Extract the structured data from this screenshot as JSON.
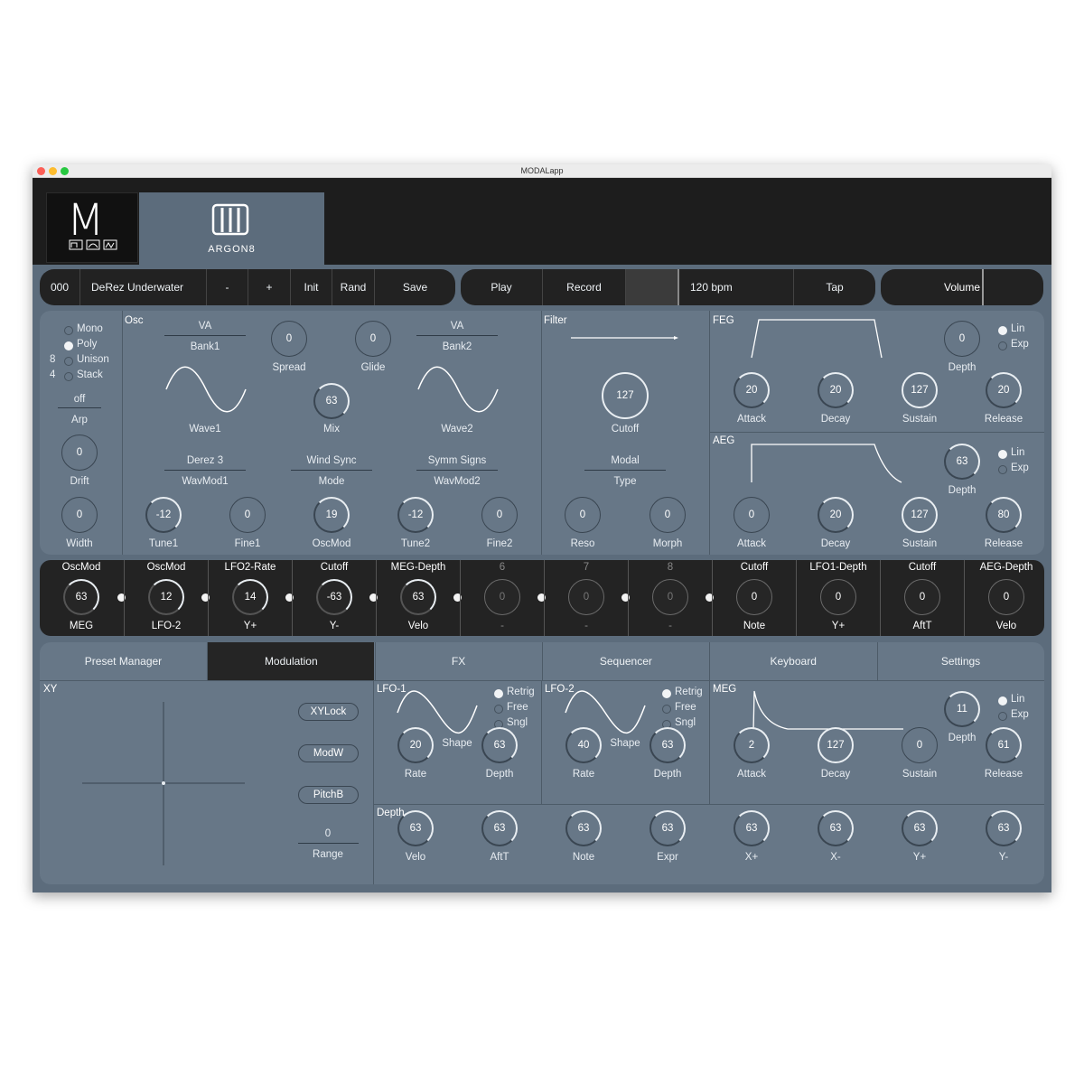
{
  "window": {
    "title": "MODALapp"
  },
  "header": {
    "logo_m": "M",
    "logo_sub": "ARGON8"
  },
  "toolbar": {
    "preset_number": "000",
    "preset_name": "DeRez Underwater",
    "minus": "-",
    "plus": "+",
    "init": "Init",
    "rand": "Rand",
    "save": "Save",
    "play": "Play",
    "record": "Record",
    "tempo": "120 bpm",
    "tap": "Tap",
    "volume": "Volume"
  },
  "voice": {
    "modes": [
      "Mono",
      "Poly",
      "Unison",
      "Stack"
    ],
    "selected_mode": "Poly",
    "unison_count": "8",
    "stack_count": "4",
    "arp_value": "off",
    "arp_label": "Arp",
    "drift_value": "0",
    "drift_label": "Drift",
    "width_value": "0",
    "width_label": "Width"
  },
  "osc": {
    "title": "Osc",
    "bank1_value": "VA",
    "bank1_label": "Bank1",
    "bank2_value": "VA",
    "bank2_label": "Bank2",
    "spread_value": "0",
    "spread_label": "Spread",
    "glide_value": "0",
    "glide_label": "Glide",
    "mix_value": "63",
    "mix_label": "Mix",
    "wave1_label": "Wave1",
    "wave2_label": "Wave2",
    "wavmod1_value": "Derez 3",
    "wavmod1_label": "WavMod1",
    "mode_value": "Wind Sync",
    "mode_label": "Mode",
    "wavmod2_value": "Symm Signs",
    "wavmod2_label": "WavMod2",
    "tune1_value": "-12",
    "tune1_label": "Tune1",
    "fine1_value": "0",
    "fine1_label": "Fine1",
    "oscmod_value": "19",
    "oscmod_label": "OscMod",
    "tune2_value": "-12",
    "tune2_label": "Tune2",
    "fine2_value": "0",
    "fine2_label": "Fine2"
  },
  "filter": {
    "title": "Filter",
    "cutoff_value": "127",
    "cutoff_label": "Cutoff",
    "type_value": "Modal",
    "type_label": "Type",
    "reso_value": "0",
    "reso_label": "Reso",
    "morph_value": "0",
    "morph_label": "Morph"
  },
  "feg": {
    "title": "FEG",
    "depth_value": "0",
    "depth_label": "Depth",
    "curve_options": [
      "Lin",
      "Exp"
    ],
    "curve_selected": "Lin",
    "attack_value": "20",
    "attack_label": "Attack",
    "decay_value": "20",
    "decay_label": "Decay",
    "sustain_value": "127",
    "sustain_label": "Sustain",
    "release_value": "20",
    "release_label": "Release"
  },
  "aeg": {
    "title": "AEG",
    "depth_value": "63",
    "depth_label": "Depth",
    "curve_options": [
      "Lin",
      "Exp"
    ],
    "curve_selected": "Lin",
    "attack_value": "0",
    "attack_label": "Attack",
    "decay_value": "20",
    "decay_label": "Decay",
    "sustain_value": "127",
    "sustain_label": "Sustain",
    "release_value": "80",
    "release_label": "Release"
  },
  "mod_matrix": [
    {
      "dest": "OscMod",
      "value": "63",
      "source": "MEG",
      "active": true
    },
    {
      "dest": "OscMod",
      "value": "12",
      "source": "LFO-2",
      "active": true
    },
    {
      "dest": "LFO2-Rate",
      "value": "14",
      "source": "Y+",
      "active": true
    },
    {
      "dest": "Cutoff",
      "value": "-63",
      "source": "Y-",
      "active": true
    },
    {
      "dest": "MEG-Depth",
      "value": "63",
      "source": "Velo",
      "active": true
    },
    {
      "dest": "6",
      "value": "0",
      "source": "-",
      "active": false
    },
    {
      "dest": "7",
      "value": "0",
      "source": "-",
      "active": false
    },
    {
      "dest": "8",
      "value": "0",
      "source": "-",
      "active": false
    },
    {
      "dest": "Cutoff",
      "value": "0",
      "source": "Note",
      "active": true
    },
    {
      "dest": "LFO1-Depth",
      "value": "0",
      "source": "Y+",
      "active": true
    },
    {
      "dest": "Cutoff",
      "value": "0",
      "source": "AftT",
      "active": true
    },
    {
      "dest": "AEG-Depth",
      "value": "0",
      "source": "Velo",
      "active": true
    }
  ],
  "tabs": [
    "Preset Manager",
    "Modulation",
    "FX",
    "Sequencer",
    "Keyboard",
    "Settings"
  ],
  "active_tab": "Modulation",
  "xy": {
    "title": "XY",
    "xylock": "XYLock",
    "modw": "ModW",
    "pitchb": "PitchB",
    "range_value": "0",
    "range_label": "Range"
  },
  "lfo1": {
    "title": "LFO-1",
    "options": [
      "Retrig",
      "Free",
      "Sngl"
    ],
    "selected": "Retrig",
    "shape_label": "Shape",
    "rate_value": "20",
    "rate_label": "Rate",
    "depth_value": "63",
    "depth_label": "Depth"
  },
  "lfo2": {
    "title": "LFO-2",
    "options": [
      "Retrig",
      "Free",
      "Sngl"
    ],
    "selected": "Retrig",
    "shape_label": "Shape",
    "rate_value": "40",
    "rate_label": "Rate",
    "depth_value": "63",
    "depth_label": "Depth"
  },
  "meg": {
    "title": "MEG",
    "depth_value": "11",
    "depth_label": "Depth",
    "curve_options": [
      "Lin",
      "Exp"
    ],
    "curve_selected": "Lin",
    "attack_value": "2",
    "attack_label": "Attack",
    "decay_value": "127",
    "decay_label": "Decay",
    "sustain_value": "0",
    "sustain_label": "Sustain",
    "release_value": "61",
    "release_label": "Release"
  },
  "depth": {
    "title": "Depth",
    "items": [
      {
        "value": "63",
        "label": "Velo"
      },
      {
        "value": "63",
        "label": "AftT"
      },
      {
        "value": "63",
        "label": "Note"
      },
      {
        "value": "63",
        "label": "Expr"
      },
      {
        "value": "63",
        "label": "X+"
      },
      {
        "value": "63",
        "label": "X-"
      },
      {
        "value": "63",
        "label": "Y+"
      },
      {
        "value": "63",
        "label": "Y-"
      }
    ]
  },
  "colors": {
    "panel": "#677787",
    "background": "#5c6c7c",
    "dark": "#222222",
    "accent": "#ffffff"
  }
}
